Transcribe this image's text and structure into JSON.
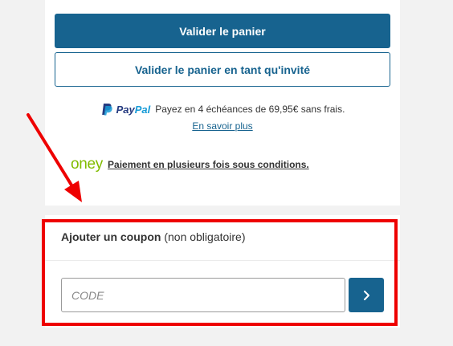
{
  "checkout": {
    "validate_cart_label": "Valider le panier",
    "validate_guest_label": "Valider le panier en tant qu'invité"
  },
  "paypal": {
    "logo_part1": "Pay",
    "logo_part2": "Pal",
    "text": "Payez en 4 échéances de 69,95€ sans frais.",
    "link_label": "En savoir plus",
    "colors": {
      "dark": "#253b80",
      "light": "#179bd7"
    }
  },
  "oney": {
    "logo_text": "oney",
    "text": "Paiement en plusieurs fois sous conditions.",
    "color": "#81bc00"
  },
  "coupon": {
    "title_bold": "Ajouter un coupon",
    "title_rest": "(non obligatoire)",
    "placeholder": "CODE",
    "submit_icon": "chevron-right-icon"
  },
  "colors": {
    "accent": "#17638f",
    "highlight": "#ee0000"
  }
}
